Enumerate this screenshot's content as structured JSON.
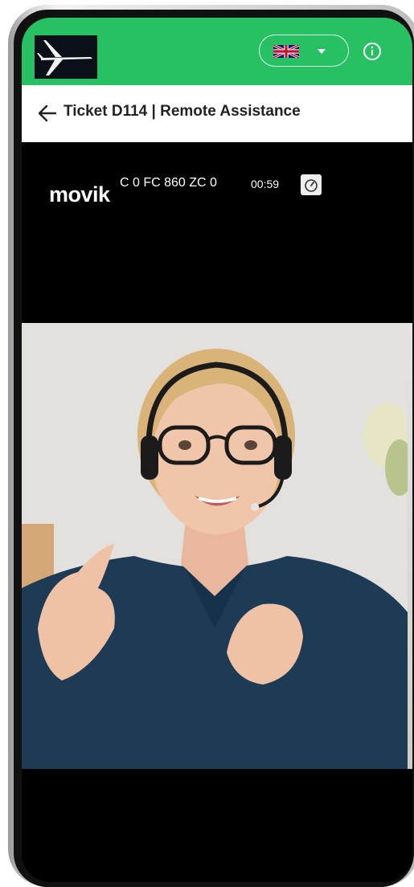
{
  "topbar": {
    "language": "English (UK)",
    "brand_color": "#27c163",
    "icons": {
      "app_logo": "airplane-logo",
      "language_flag": "uk-flag-icon",
      "dropdown": "chevron-down-icon",
      "info": "info-icon"
    }
  },
  "header": {
    "title": "Ticket D114 | Remote Assistance",
    "back_icon": "arrow-left-icon"
  },
  "video": {
    "brand": "movik",
    "session_code": "C 0 FC 860 ZC 0",
    "timer": "00:59",
    "speed_icon": "speedometer-icon"
  }
}
